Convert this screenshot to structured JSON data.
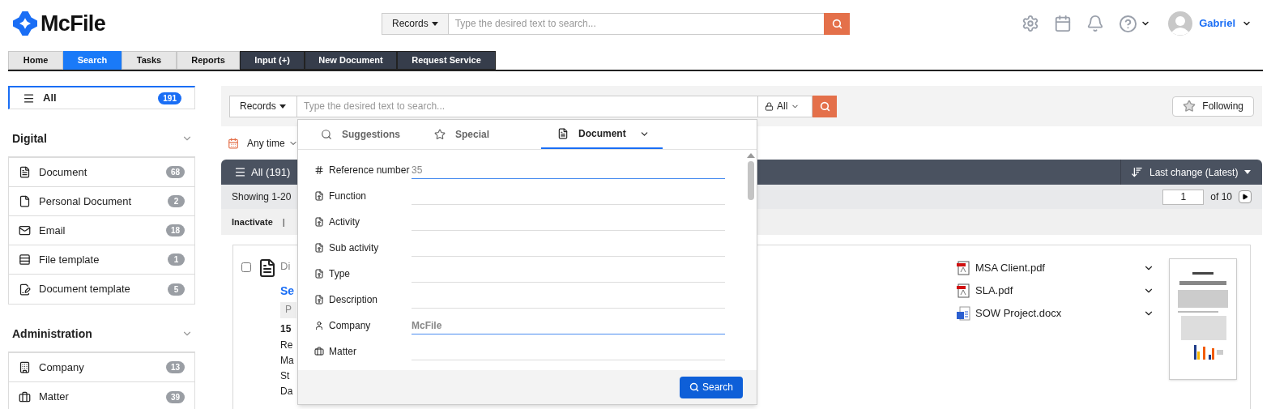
{
  "header": {
    "logo": "McFile",
    "search": {
      "scope": "Records",
      "placeholder": "Type the desired text to search..."
    },
    "user": {
      "name": "Gabriel"
    }
  },
  "nav_tabs": [
    {
      "label": "Home",
      "selected": false,
      "kind": "light"
    },
    {
      "label": "Search",
      "selected": true,
      "kind": "light"
    },
    {
      "label": "Tasks",
      "selected": false,
      "kind": "light"
    },
    {
      "label": "Reports",
      "selected": false,
      "kind": "light"
    },
    {
      "label": "Input (+)",
      "selected": false,
      "kind": "dark"
    },
    {
      "label": "New Document",
      "selected": false,
      "kind": "dark"
    },
    {
      "label": "Request Service",
      "selected": false,
      "kind": "dark"
    }
  ],
  "sidebar": {
    "all": {
      "label": "All",
      "count": "191",
      "selected": true
    },
    "sections": [
      {
        "title": "Digital",
        "items": [
          {
            "label": "Document",
            "count": "68",
            "selected": false
          },
          {
            "label": "Personal Document",
            "count": "2",
            "selected": false
          },
          {
            "label": "Email",
            "count": "18",
            "selected": false
          },
          {
            "label": "File template",
            "count": "1",
            "selected": false
          },
          {
            "label": "Document template",
            "count": "5",
            "selected": false
          }
        ]
      },
      {
        "title": "Administration",
        "items": [
          {
            "label": "Company",
            "count": "13",
            "selected": false
          },
          {
            "label": "Matter",
            "count": "39",
            "selected": false
          }
        ]
      }
    ]
  },
  "search_bar": {
    "scope": "Records",
    "placeholder": "Type the desired text to search...",
    "access": "All",
    "following": "Following"
  },
  "filter": {
    "time": "Any time"
  },
  "results_bar": {
    "title": "All (191)",
    "sort": "Last change (Latest)",
    "showing": "Showing 1-20",
    "page": "1",
    "of": "of 10",
    "action": "Inactivate",
    "separator": "|"
  },
  "result": {
    "checked": false,
    "lines": [
      {
        "text": "Di",
        "kind": "title"
      },
      {
        "text": "Se",
        "kind": "link"
      },
      {
        "text": "P",
        "kind": "tag"
      },
      {
        "text": "15",
        "kind": "bold"
      },
      {
        "text": "Re",
        "kind": "plain"
      },
      {
        "text": "Ma",
        "kind": "plain"
      },
      {
        "text": "St",
        "kind": "plain"
      },
      {
        "text": "Da",
        "kind": "plain"
      }
    ],
    "files": [
      {
        "name": "MSA Client.pdf",
        "kind": "pdf"
      },
      {
        "name": "SLA.pdf",
        "kind": "pdf"
      },
      {
        "name": "SOW Project.docx",
        "kind": "word"
      }
    ]
  },
  "dropdown": {
    "tabs": [
      {
        "label": "Suggestions",
        "selected": false
      },
      {
        "label": "Special",
        "selected": false
      },
      {
        "label": "Document",
        "selected": true
      }
    ],
    "fields": [
      {
        "label": "Reference number",
        "value": "35"
      },
      {
        "label": "Function"
      },
      {
        "label": "Activity"
      },
      {
        "label": "Sub activity"
      },
      {
        "label": "Type"
      },
      {
        "label": "Description"
      },
      {
        "label": "Company",
        "value": "McFile"
      },
      {
        "label": "Matter"
      }
    ],
    "button": "Search"
  }
}
